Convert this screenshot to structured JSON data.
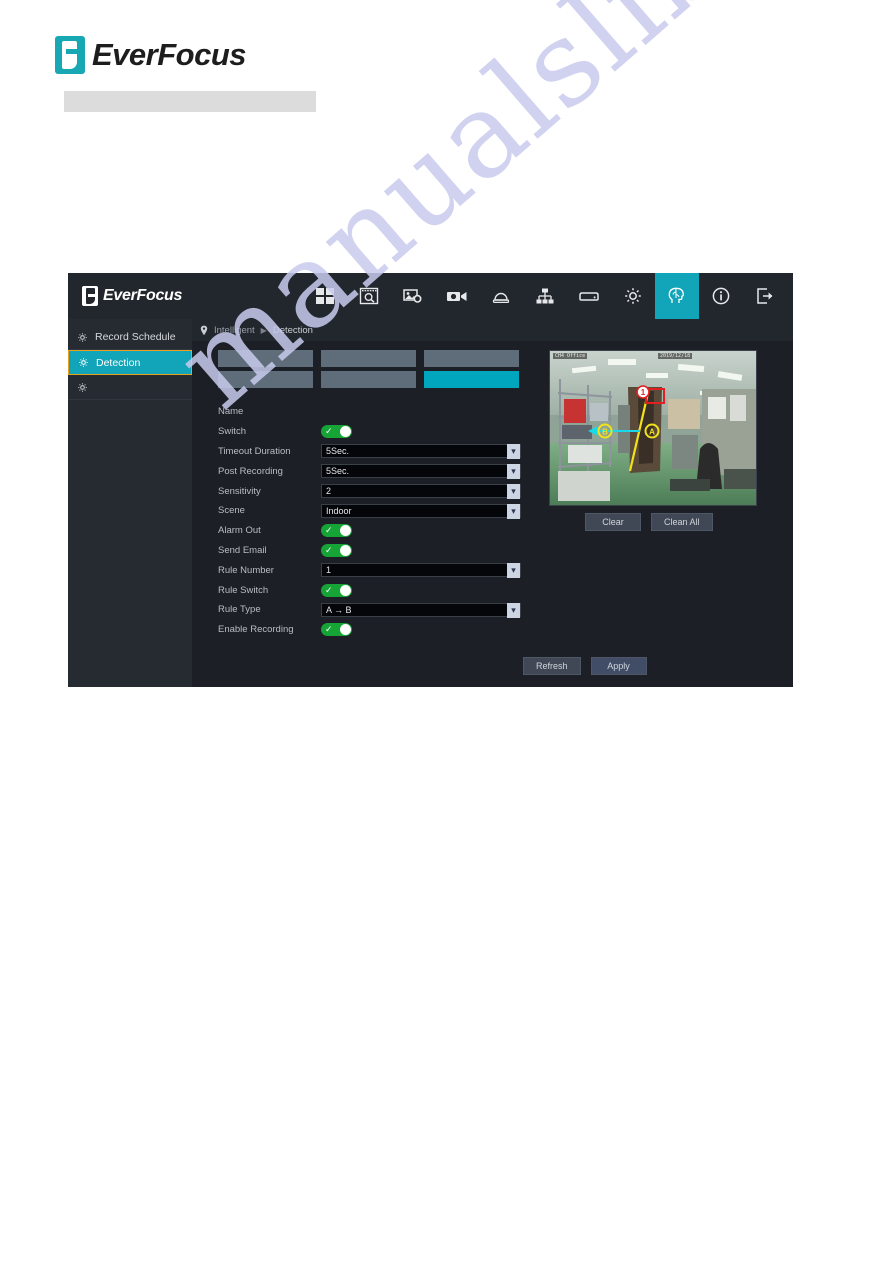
{
  "page": {
    "brand_name": "EverFocus",
    "watermark": "manualslib"
  },
  "dvr": {
    "logo_text": "EverFocus",
    "toolbar": [
      {
        "name": "live-view-grid-icon",
        "label": "Live View"
      },
      {
        "name": "playback-search-icon",
        "label": "Playback"
      },
      {
        "name": "image-settings-icon",
        "label": "Image Settings"
      },
      {
        "name": "camera-record-icon",
        "label": "Camera"
      },
      {
        "name": "alarm-bell-icon",
        "label": "Alarm"
      },
      {
        "name": "network-icon",
        "label": "Network"
      },
      {
        "name": "storage-disk-icon",
        "label": "Disk"
      },
      {
        "name": "system-gear-icon",
        "label": "System"
      },
      {
        "name": "intelligent-head-icon",
        "label": "Intelligent",
        "active": true
      },
      {
        "name": "info-icon",
        "label": "Information"
      },
      {
        "name": "logout-icon",
        "label": "Logout"
      }
    ],
    "sidebar": {
      "items": [
        {
          "label": "Record Schedule",
          "active": false
        },
        {
          "label": "Detection",
          "active": true
        },
        {
          "label": "",
          "active": false
        }
      ]
    },
    "breadcrumb": {
      "root": "Intelligent",
      "separator": "▶",
      "current": "Detection"
    },
    "tabs": {
      "cells": [
        "",
        "",
        "",
        "",
        "",
        ""
      ],
      "highlighted_index": 5
    },
    "form": {
      "rows": [
        {
          "label": "Name",
          "type": "text",
          "value": ""
        },
        {
          "label": "Switch",
          "type": "toggle",
          "value": "on"
        },
        {
          "label": "Timeout Duration",
          "type": "select",
          "value": "5Sec."
        },
        {
          "label": "Post Recording",
          "type": "select",
          "value": "5Sec."
        },
        {
          "label": "Sensitivity",
          "type": "select",
          "value": "2"
        },
        {
          "label": "Scene",
          "type": "select",
          "value": "Indoor"
        },
        {
          "label": "Alarm Out",
          "type": "toggle",
          "value": "on"
        },
        {
          "label": "Send Email",
          "type": "toggle",
          "value": "on"
        },
        {
          "label": "Rule Number",
          "type": "select",
          "value": "1"
        },
        {
          "label": "Rule Switch",
          "type": "toggle",
          "value": "on"
        },
        {
          "label": "Rule Type",
          "type": "select",
          "value": "A → B"
        },
        {
          "label": "Enable Recording",
          "type": "toggle",
          "value": "on"
        }
      ]
    },
    "preview": {
      "osd_left": "CH4 Office",
      "osd_right": "2019/12/18",
      "markers": {
        "a": "A",
        "b": "B",
        "rule_number": "1"
      }
    },
    "preview_buttons": {
      "clear": "Clear",
      "clean_all": "Clean All"
    },
    "action_buttons": {
      "refresh": "Refresh",
      "apply": "Apply"
    }
  }
}
